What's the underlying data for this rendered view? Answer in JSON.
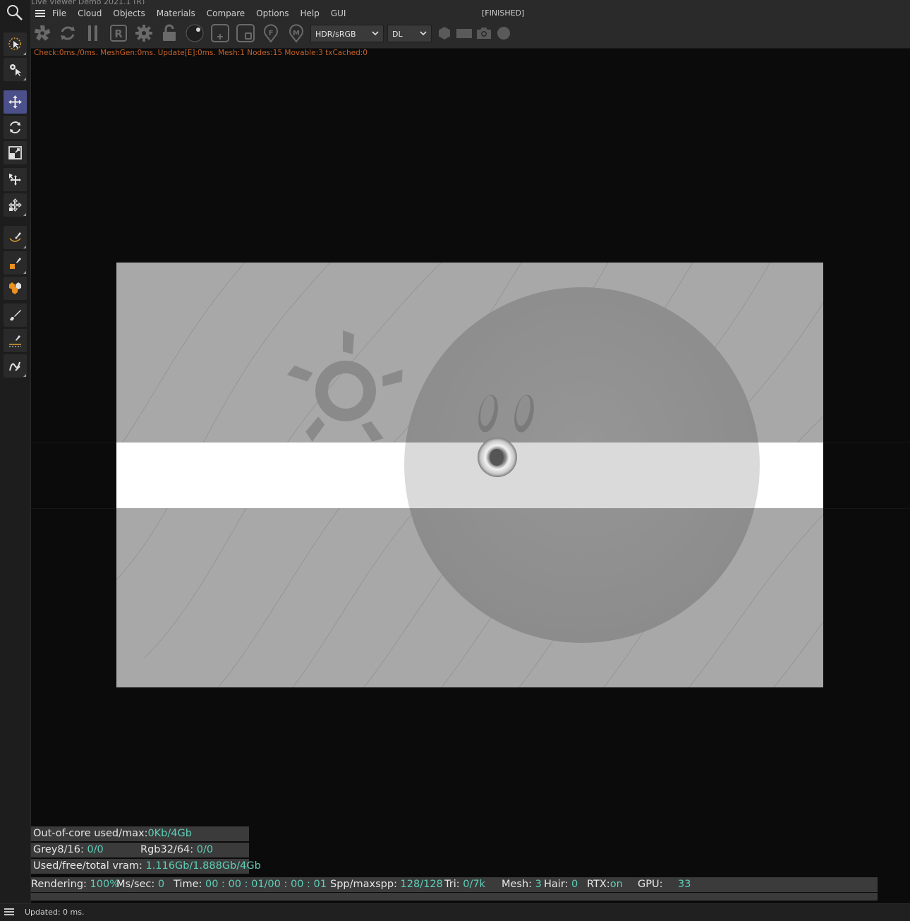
{
  "window": {
    "title": "Live Viewer Demo 2021.1 (R)"
  },
  "menu": {
    "items": [
      "File",
      "Cloud",
      "Objects",
      "Materials",
      "Compare",
      "Options",
      "Help",
      "GUI"
    ],
    "status": "[FINISHED]"
  },
  "toolbar": {
    "kernel_select": "HDR/sRGB",
    "mode_select": "DL"
  },
  "diagnostics": "Check:0ms./0ms. MeshGen:0ms. Update[E]:0ms. Mesh:1 Nodes:15 Movable:3 txCached:0",
  "memory": {
    "ooc_label": "Out-of-core used/max:",
    "ooc_value": "0Kb/4Gb",
    "grey_label": "Grey8/16: ",
    "grey_value": "0/0",
    "rgb_label": "Rgb32/64: ",
    "rgb_value": "0/0",
    "vram_label": "Used/free/total vram: ",
    "vram_value": "1.116Gb/1.888Gb/4Gb"
  },
  "render_stats": {
    "rendering_label": "Rendering: ",
    "rendering_value": "100%",
    "mssec_label": "Ms/sec: ",
    "mssec_value": "0",
    "time_label": "Time: ",
    "time_value": "00 : 00 : 01/00 : 00 : 01",
    "spp_label": "Spp/maxspp: ",
    "spp_value": "128/128",
    "tri_label": "Tri: ",
    "tri_value": "0/7k",
    "mesh_label": "Mesh: ",
    "mesh_value": "3",
    "hair_label": "Hair: ",
    "hair_value": "0",
    "rtx_label": "RTX:",
    "rtx_value": "on",
    "gpu_label": "GPU:",
    "gpu_value": "33"
  },
  "status_bar": {
    "text": "Updated: 0 ms."
  },
  "colors": {
    "accent_value": "#5ecfb8",
    "diag_text": "#c4632a",
    "active_tool": "#4b4f8a"
  }
}
